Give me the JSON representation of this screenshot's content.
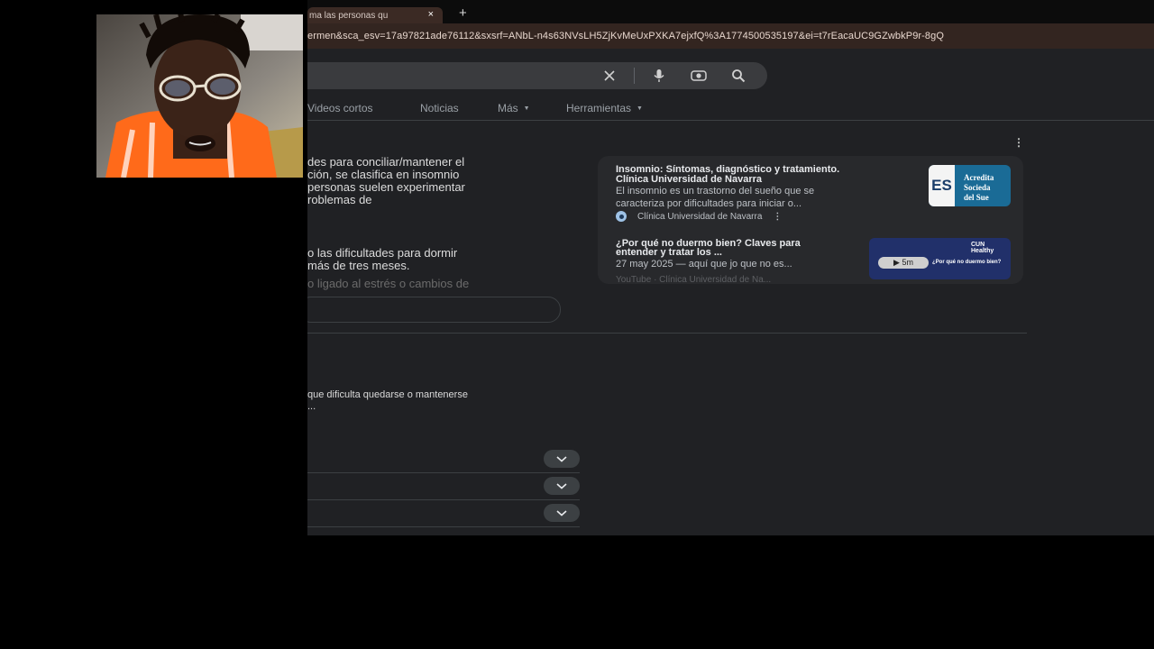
{
  "tab": {
    "title": "ma las personas qu",
    "close": "×",
    "new_tab": "+"
  },
  "address_bar": {
    "url": "ermen&sca_esv=17a97821ade76112&sxsrf=ANbL-n4s63NVsLH5ZjKvMeUxPXKA7ejxfQ%3A1774500535197&ei=t7rEacaUC9GZwbkP9r-8gQ"
  },
  "search_icons": [
    "clear-icon",
    "microphone-icon",
    "lens-icon",
    "search-icon"
  ],
  "nav_tabs": [
    {
      "label": "Videos cortos",
      "caret": ""
    },
    {
      "label": "Noticias",
      "caret": ""
    },
    {
      "label": "Más",
      "caret": "▼"
    },
    {
      "label": "Herramientas",
      "caret": "▼"
    }
  ],
  "overview": {
    "lines": [
      "des para conciliar/mantener el",
      "ción, se clasifica en insomnio",
      "personas suelen experimentar",
      "roblemas de",
      "o las dificultades para dormir",
      "más de tres meses.",
      "o ligado al estrés o cambios de"
    ]
  },
  "paragraph": {
    "lines": [
      "que dificulta quedarse o mantenerse",
      "..."
    ]
  },
  "faq_chevron": "⌄",
  "ai_panel": {
    "kebab": "⋮",
    "cards": [
      {
        "title_lines": [
          "Insomnio: Síntomas, diagnóstico y tratamiento.",
          "Clínica Universidad de Navarra"
        ],
        "text_lines": [
          "El insomnio es un trastorno del sueño que se",
          "caracteriza por dificultades para iniciar o..."
        ],
        "source": "Clínica Universidad de Navarra",
        "thumb_text": "ES",
        "thumb_side_lines": [
          "Acredita",
          "Socieda",
          "del Sue"
        ]
      },
      {
        "title_lines": [
          "¿Por qué no duermo bien? Claves para",
          "entender y tratar los ..."
        ],
        "text_lines": [
          "27 may 2025 — aquí que jo que no es..."
        ],
        "source": "YouTube · Clínica Universidad de Na...",
        "thumb_badge": "CUN",
        "thumb_sub": "Healthy",
        "duration": "▶ 5m",
        "thumb_question": "¿Por qué no duermo bien?"
      }
    ]
  },
  "webcam": {
    "label": "webcam-overlay"
  }
}
